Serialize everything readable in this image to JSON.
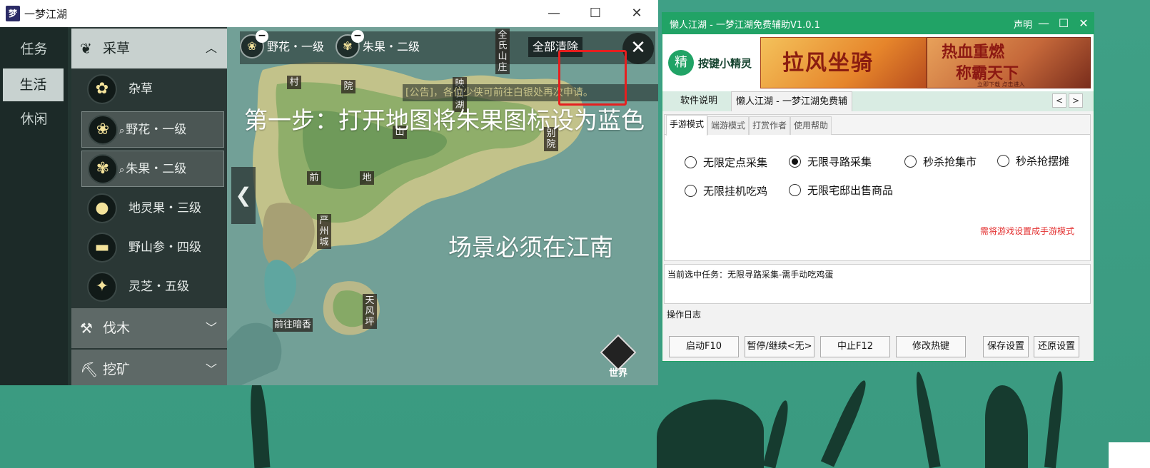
{
  "game": {
    "title": "一梦江湖",
    "app_icon": "梦",
    "window_controls": {
      "minimize": "—",
      "maximize": "☐",
      "close": "✕"
    },
    "left_tabs": [
      "任务",
      "生活",
      "休闲"
    ],
    "categories": {
      "herb": {
        "label": "采草",
        "icon": "herb-icon"
      },
      "wood": {
        "label": "伐木",
        "icon": "axe-icon"
      },
      "mine": {
        "label": "挖矿",
        "icon": "pickaxe-icon"
      }
    },
    "items": [
      {
        "label": "杂草",
        "icon": "weed-icon",
        "glyph": "✿"
      },
      {
        "label": "野花・一级",
        "icon": "wildflower-icon",
        "glyph": "❀",
        "selected": true
      },
      {
        "label": "朱果・二级",
        "icon": "red-fruit-icon",
        "glyph": "✾",
        "selected": true
      },
      {
        "label": "地灵果・三级",
        "icon": "earth-fruit-icon",
        "glyph": "●"
      },
      {
        "label": "野山参・四级",
        "icon": "ginseng-icon",
        "glyph": "▬"
      },
      {
        "label": "灵芝・五级",
        "icon": "lingzhi-icon",
        "glyph": "✦"
      }
    ],
    "map": {
      "tracked": [
        {
          "label": "野花・一级",
          "icon": "wildflower-icon"
        },
        {
          "label": "朱果・二级",
          "icon": "red-fruit-icon"
        }
      ],
      "clear_all": "全部清除",
      "notice": "[公告]，各位少侠可前往白银处再次申请。",
      "step_text": "第一步：打开地图将朱果图标设为蓝色",
      "scene_text": "场景必须在江南",
      "world_label": "世界",
      "place_labels": {
        "quanshi": "全氏山庄",
        "yingri": "映日湖",
        "bie": "别院",
        "yanzhou": "严州城",
        "tianfeng": "天风坪",
        "anxiang": "前往暗香",
        "cun": "村",
        "yuan": "院",
        "shan": "山",
        "di": "地",
        "qian": "前"
      }
    }
  },
  "helper": {
    "title": "懒人江湖 - 一梦江湖免费辅助V1.0.1",
    "statement": "声明",
    "window_controls": {
      "minimize": "—",
      "maximize": "☐",
      "close": "✕"
    },
    "brand": "按键小精灵",
    "brand_logo": "精",
    "ads": {
      "ad1": "拉风坐骑",
      "ad2_line1": "热血重燃",
      "ad2_line2": "称霸天下",
      "ad2_small": "立即下载 点击进入"
    },
    "main_tabs": [
      "软件说明",
      "懒人江湖 - 一梦江湖免费辅助"
    ],
    "nav": {
      "prev": "<",
      "next": ">"
    },
    "sub_tabs": [
      "手游模式",
      "端游模式",
      "打赏作者",
      "使用帮助"
    ],
    "options": [
      {
        "label": "无限定点采集",
        "checked": false
      },
      {
        "label": "无限寻路采集",
        "checked": true
      },
      {
        "label": "秒杀抢集市",
        "checked": false
      },
      {
        "label": "秒杀抢摆摊",
        "checked": false
      },
      {
        "label": "无限挂机吃鸡",
        "checked": false
      },
      {
        "label": "无限宅邸出售商品",
        "checked": false
      }
    ],
    "hint": "需将游戏设置成手游模式",
    "current_task": "当前选中任务：无限寻路采集-需手动吃鸡蛋",
    "log_label": "操作日志",
    "buttons": [
      "启动F10",
      "暂停/继续<无>",
      "中止F12",
      "修改热键",
      "保存设置",
      "还原设置"
    ]
  },
  "colors": {
    "accent_green": "#21a366",
    "highlight_red": "#e61f1f",
    "hint_red": "#e33030"
  }
}
